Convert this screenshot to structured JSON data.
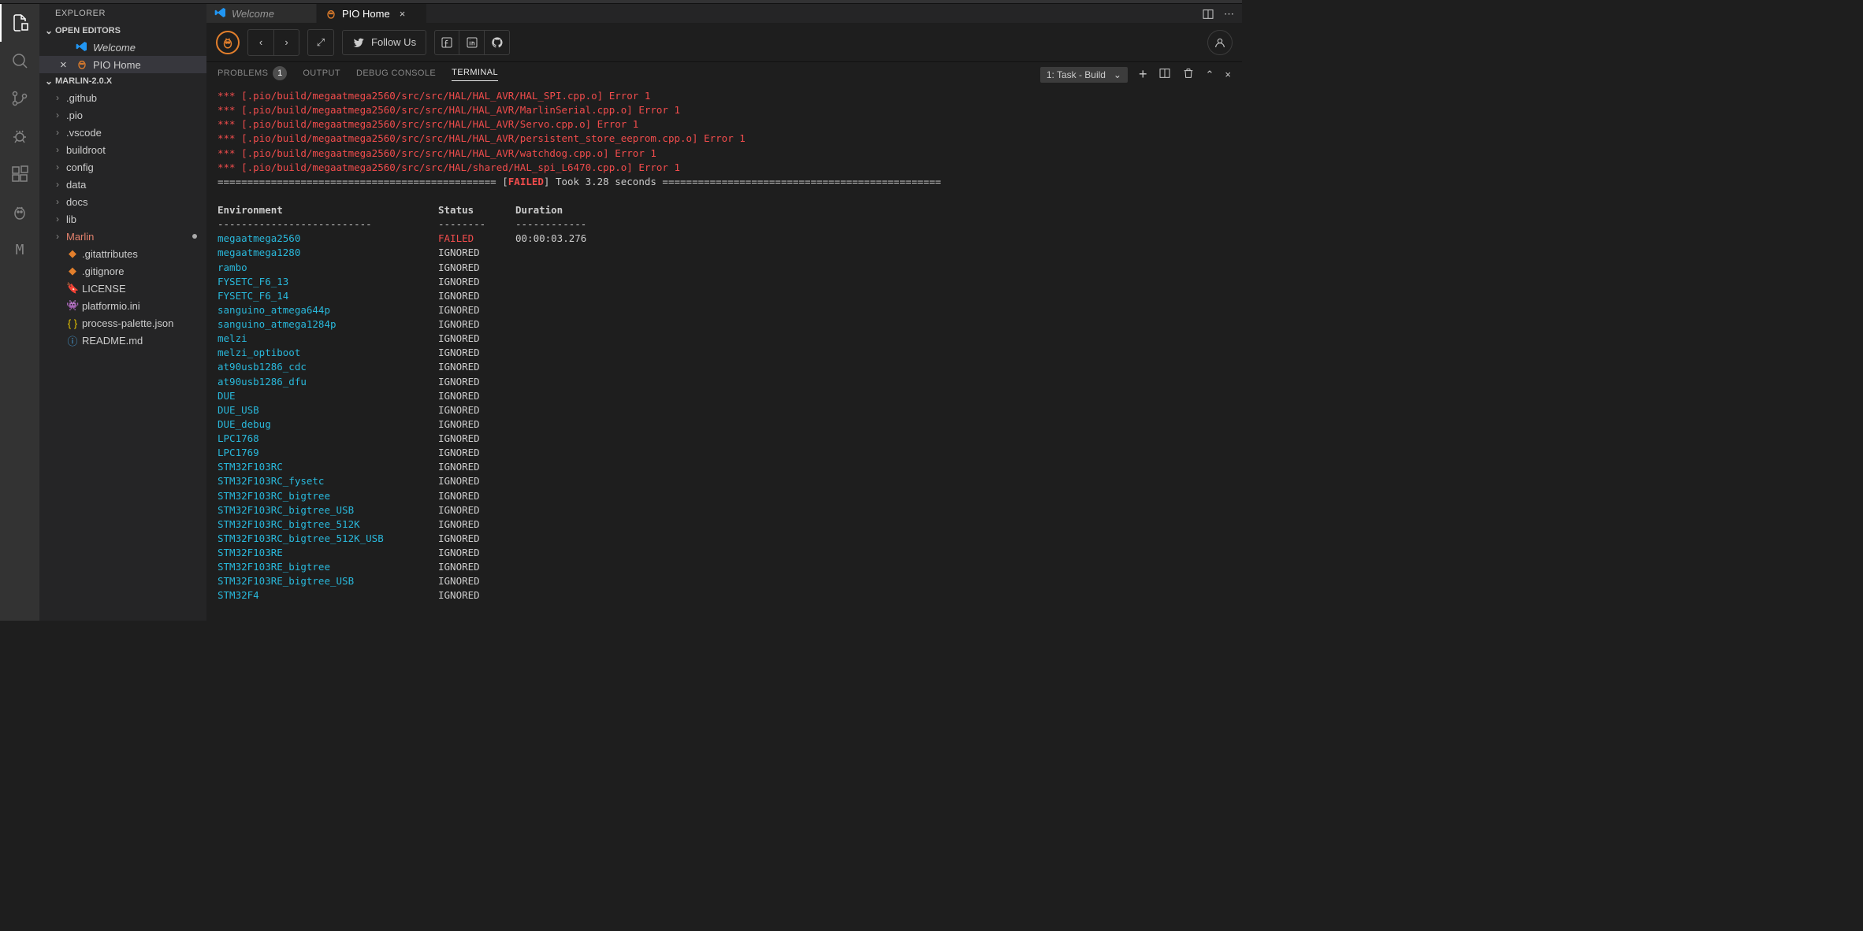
{
  "sidebar": {
    "title": "EXPLORER",
    "openEditors": {
      "header": "OPEN EDITORS",
      "items": [
        {
          "label": "Welcome",
          "active": false
        },
        {
          "label": "PIO Home",
          "active": true
        }
      ]
    },
    "project": {
      "header": "MARLIN-2.0.X",
      "folders": [
        ".github",
        ".pio",
        ".vscode",
        "buildroot",
        "config",
        "data",
        "docs",
        "lib"
      ],
      "highlightFolder": "Marlin",
      "files": [
        {
          "name": ".gitattributes",
          "icon": "git"
        },
        {
          "name": ".gitignore",
          "icon": "git"
        },
        {
          "name": "LICENSE",
          "icon": "cert"
        },
        {
          "name": "platformio.ini",
          "icon": "pio"
        },
        {
          "name": "process-palette.json",
          "icon": "json"
        },
        {
          "name": "README.md",
          "icon": "info"
        }
      ]
    }
  },
  "tabs": {
    "welcome": "Welcome",
    "piohome": "PIO Home"
  },
  "pio": {
    "follow": "Follow Us"
  },
  "panel": {
    "problems": "PROBLEMS",
    "problemsCount": "1",
    "output": "OUTPUT",
    "debug": "DEBUG CONSOLE",
    "terminal": "TERMINAL",
    "task": "1: Task - Build"
  },
  "terminal": {
    "errors": [
      "*** [.pio/build/megaatmega2560/src/src/HAL/HAL_AVR/HAL_SPI.cpp.o] Error 1",
      "*** [.pio/build/megaatmega2560/src/src/HAL/HAL_AVR/MarlinSerial.cpp.o] Error 1",
      "*** [.pio/build/megaatmega2560/src/src/HAL/HAL_AVR/Servo.cpp.o] Error 1",
      "*** [.pio/build/megaatmega2560/src/src/HAL/HAL_AVR/persistent_store_eeprom.cpp.o] Error 1",
      "*** [.pio/build/megaatmega2560/src/src/HAL/HAL_AVR/watchdog.cpp.o] Error 1",
      "*** [.pio/build/megaatmega2560/src/src/HAL/shared/HAL_spi_L6470.cpp.o] Error 1"
    ],
    "failedWord": "FAILED",
    "tookText": "] Took 3.28 seconds ",
    "headers": {
      "env": "Environment",
      "status": "Status",
      "duration": "Duration"
    },
    "envs": [
      {
        "name": "megaatmega2560",
        "status": "FAILED",
        "duration": "00:00:03.276"
      },
      {
        "name": "megaatmega1280",
        "status": "IGNORED"
      },
      {
        "name": "rambo",
        "status": "IGNORED"
      },
      {
        "name": "FYSETC_F6_13",
        "status": "IGNORED"
      },
      {
        "name": "FYSETC_F6_14",
        "status": "IGNORED"
      },
      {
        "name": "sanguino_atmega644p",
        "status": "IGNORED"
      },
      {
        "name": "sanguino_atmega1284p",
        "status": "IGNORED"
      },
      {
        "name": "melzi",
        "status": "IGNORED"
      },
      {
        "name": "melzi_optiboot",
        "status": "IGNORED"
      },
      {
        "name": "at90usb1286_cdc",
        "status": "IGNORED"
      },
      {
        "name": "at90usb1286_dfu",
        "status": "IGNORED"
      },
      {
        "name": "DUE",
        "status": "IGNORED"
      },
      {
        "name": "DUE_USB",
        "status": "IGNORED"
      },
      {
        "name": "DUE_debug",
        "status": "IGNORED"
      },
      {
        "name": "LPC1768",
        "status": "IGNORED"
      },
      {
        "name": "LPC1769",
        "status": "IGNORED"
      },
      {
        "name": "STM32F103RC",
        "status": "IGNORED"
      },
      {
        "name": "STM32F103RC_fysetc",
        "status": "IGNORED"
      },
      {
        "name": "STM32F103RC_bigtree",
        "status": "IGNORED"
      },
      {
        "name": "STM32F103RC_bigtree_USB",
        "status": "IGNORED"
      },
      {
        "name": "STM32F103RC_bigtree_512K",
        "status": "IGNORED"
      },
      {
        "name": "STM32F103RC_bigtree_512K_USB",
        "status": "IGNORED"
      },
      {
        "name": "STM32F103RE",
        "status": "IGNORED"
      },
      {
        "name": "STM32F103RE_bigtree",
        "status": "IGNORED"
      },
      {
        "name": "STM32F103RE_bigtree_USB",
        "status": "IGNORED"
      },
      {
        "name": "STM32F4",
        "status": "IGNORED"
      }
    ]
  }
}
